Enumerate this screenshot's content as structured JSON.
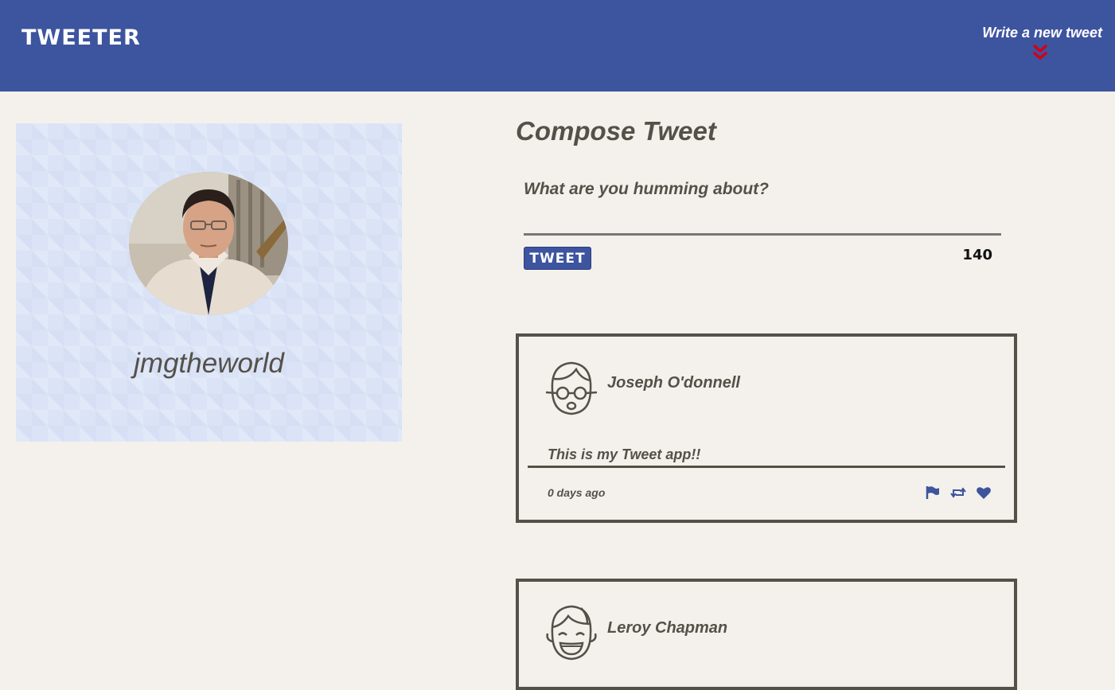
{
  "nav": {
    "brand": "TWEETER",
    "compose_toggle": "Write a new tweet",
    "toggle_icon": "double-chevron-down-icon"
  },
  "colors": {
    "nav_background": "#3d549f",
    "page_background": "#f4f1ec",
    "text": "#545149",
    "toggle_arrow": "#d0021b",
    "profile_card": "#dbe3f6"
  },
  "profile": {
    "handle": "jmgtheworld",
    "avatar": "user-photo"
  },
  "compose": {
    "title": "Compose Tweet",
    "placeholder": "What are you humming about?",
    "button_label": "TWEET",
    "char_count": "140"
  },
  "tweets": [
    {
      "author": "Joseph O'donnell",
      "avatar": "glasses-face-avatar-icon",
      "content": "This is my Tweet app!!",
      "time": "0 days ago",
      "actions": [
        "flag-icon",
        "retweet-icon",
        "heart-icon"
      ]
    },
    {
      "author": "Leroy Chapman",
      "avatar": "smiling-face-avatar-icon"
    }
  ]
}
